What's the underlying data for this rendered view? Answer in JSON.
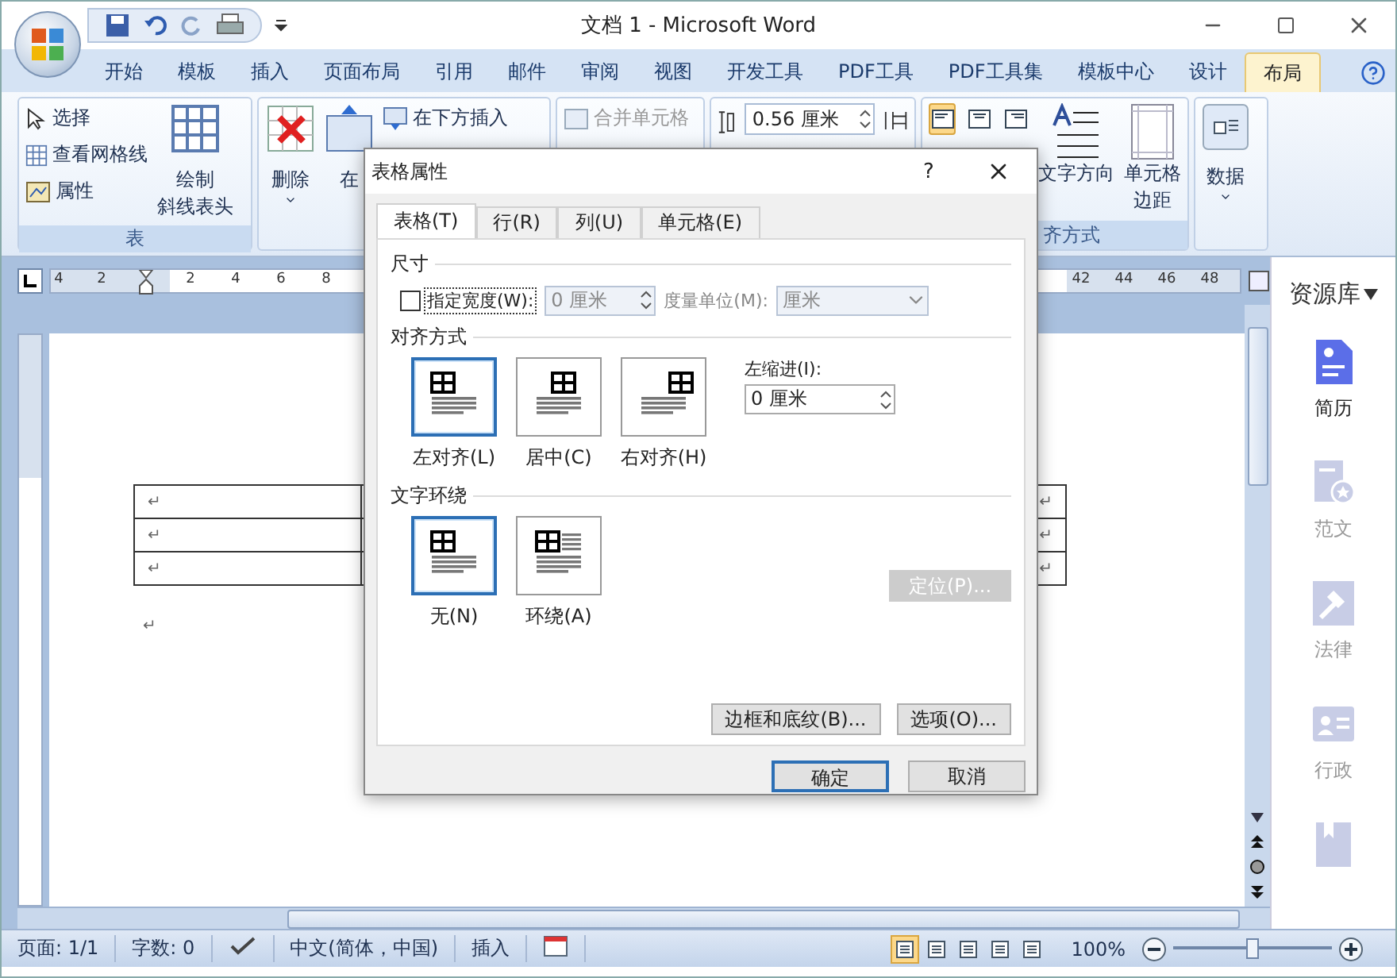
{
  "window": {
    "title": "文档 1 - Microsoft Word"
  },
  "ribbon_tabs": [
    {
      "label": "开始",
      "selected": false
    },
    {
      "label": "模板",
      "selected": false
    },
    {
      "label": "插入",
      "selected": false
    },
    {
      "label": "页面布局",
      "selected": false
    },
    {
      "label": "引用",
      "selected": false
    },
    {
      "label": "邮件",
      "selected": false
    },
    {
      "label": "审阅",
      "selected": false
    },
    {
      "label": "视图",
      "selected": false
    },
    {
      "label": "开发工具",
      "selected": false
    },
    {
      "label": "PDF工具",
      "selected": false
    },
    {
      "label": "PDF工具集",
      "selected": false
    },
    {
      "label": "模板中心",
      "selected": false
    },
    {
      "label": "设计",
      "selected": false
    },
    {
      "label": "布局",
      "selected": true
    }
  ],
  "table_group": {
    "items": [
      {
        "label": "选择",
        "kind": "select"
      },
      {
        "label": "查看网格线",
        "kind": "grid"
      },
      {
        "label": "属性",
        "kind": "props"
      }
    ],
    "draw_lines": [
      "绘制",
      "斜线表头"
    ],
    "label": "表"
  },
  "rows_group": {
    "delete": "删除",
    "insert_above_partial": "在",
    "insert_below": "在下方插入"
  },
  "merge_group": {
    "merge": "合并单元格"
  },
  "size_group": {
    "height": "0.56 厘米"
  },
  "align_group": {
    "align_buttons": [
      {
        "selected": true
      },
      {
        "selected": false
      },
      {
        "selected": false
      }
    ],
    "text_direction": "文字方向",
    "margins": [
      "单元格",
      "边距"
    ],
    "label_partial": "齐方式"
  },
  "data_group": {
    "label": "数据"
  },
  "ruler": {
    "left_numbers": [
      "4",
      "2"
    ],
    "numbers": [
      "2",
      "4",
      "6",
      "8"
    ],
    "right_numbers": [
      "42",
      "44",
      "46",
      "48"
    ]
  },
  "document": {
    "rows": [
      {
        "left": "↵",
        "right": "↵"
      },
      {
        "left": "↵",
        "right": "↵"
      },
      {
        "left": "↵",
        "right": "↵"
      }
    ],
    "paragraph": "↵"
  },
  "resource_panel": {
    "title": "资源库",
    "items": [
      {
        "label": "简历",
        "selected": true,
        "kind": "resume"
      },
      {
        "label": "范文",
        "selected": false,
        "kind": "sample"
      },
      {
        "label": "法律",
        "selected": false,
        "kind": "law"
      },
      {
        "label": "行政",
        "selected": false,
        "kind": "admin"
      },
      {
        "selected": false,
        "kind": "book"
      }
    ]
  },
  "status_bar": {
    "page": "页面: 1/1",
    "words": "字数: 0",
    "language": "中文(简体，中国)",
    "mode": "插入",
    "views": [
      {
        "selected": true
      },
      {
        "selected": false
      },
      {
        "selected": false
      },
      {
        "selected": false
      },
      {
        "selected": false
      }
    ],
    "zoom": "100%",
    "zoom_slider": {
      "level": 0.5
    }
  },
  "dialog": {
    "title": "表格属性",
    "help": "?",
    "tabs": [
      {
        "label": "表格(T)",
        "selected": true
      },
      {
        "label": "行(R)",
        "selected": false
      },
      {
        "label": "列(U)",
        "selected": false
      },
      {
        "label": "单元格(E)",
        "selected": false
      }
    ],
    "size": {
      "heading": "尺寸",
      "width_check": {
        "label": "指定宽度(W):",
        "checked": false
      },
      "width_value": "0 厘米",
      "unit_label": "度量单位(M):",
      "unit_value": "厘米"
    },
    "alignment": {
      "heading": "对齐方式",
      "options": [
        {
          "label": "左对齐(L)",
          "selected": true,
          "kind": "left"
        },
        {
          "label": "居中(C)",
          "selected": false,
          "kind": "center"
        },
        {
          "label": "右对齐(H)",
          "selected": false,
          "kind": "right"
        }
      ],
      "indent_label": "左缩进(I):",
      "indent_value": "0 厘米"
    },
    "wrapping": {
      "heading": "文字环绕",
      "options": [
        {
          "label": "无(N)",
          "selected": true,
          "kind": "none"
        },
        {
          "label": "环绕(A)",
          "selected": false,
          "kind": "around"
        }
      ],
      "position_button": {
        "label": "定位(P)...",
        "disabled": true
      }
    },
    "buttons": [
      "边框和底纹(B)...",
      "选项(O)..."
    ],
    "ok": "确定",
    "cancel": "取消"
  }
}
